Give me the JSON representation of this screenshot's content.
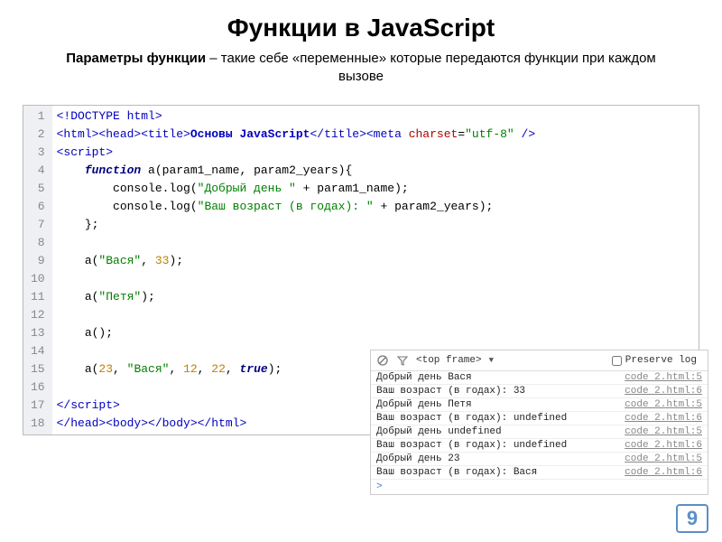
{
  "header": {
    "title": "Функции в JavaScript",
    "subtitle_bold": "Параметры функции",
    "subtitle_rest": " – такие себе «переменные» которые передаются функции при каждом вызове"
  },
  "editor": {
    "lines": [
      {
        "n": 1,
        "tokens": [
          {
            "t": "<!DOCTYPE html>",
            "c": "tag"
          }
        ]
      },
      {
        "n": 2,
        "tokens": [
          {
            "t": "<html><head><title>",
            "c": "tag"
          },
          {
            "t": "Основы JavaScript",
            "c": "kw"
          },
          {
            "t": "</title><meta",
            "c": "tag"
          },
          {
            "t": " ",
            "c": "plain"
          },
          {
            "t": "charset",
            "c": "attr"
          },
          {
            "t": "=",
            "c": "punct"
          },
          {
            "t": "\"utf-8\"",
            "c": "str"
          },
          {
            "t": " />",
            "c": "tag"
          }
        ]
      },
      {
        "n": 3,
        "tokens": [
          {
            "t": "<script>",
            "c": "tag"
          }
        ]
      },
      {
        "n": 4,
        "tokens": [
          {
            "t": "    ",
            "c": "plain"
          },
          {
            "t": "function",
            "c": "kw2"
          },
          {
            "t": " a(param1_name, param2_years){",
            "c": "plain"
          }
        ]
      },
      {
        "n": 5,
        "tokens": [
          {
            "t": "        console.log(",
            "c": "plain"
          },
          {
            "t": "\"Добрый день \"",
            "c": "str2"
          },
          {
            "t": " + param1_name);",
            "c": "plain"
          }
        ]
      },
      {
        "n": 6,
        "tokens": [
          {
            "t": "        console.log(",
            "c": "plain"
          },
          {
            "t": "\"Ваш возраст (в годах): \"",
            "c": "str2"
          },
          {
            "t": " + param2_years);",
            "c": "plain"
          }
        ]
      },
      {
        "n": 7,
        "tokens": [
          {
            "t": "    };",
            "c": "plain"
          }
        ]
      },
      {
        "n": 8,
        "tokens": []
      },
      {
        "n": 9,
        "tokens": [
          {
            "t": "    a(",
            "c": "plain"
          },
          {
            "t": "\"Вася\"",
            "c": "str2"
          },
          {
            "t": ", ",
            "c": "plain"
          },
          {
            "t": "33",
            "c": "num"
          },
          {
            "t": ");",
            "c": "plain"
          }
        ]
      },
      {
        "n": 10,
        "tokens": []
      },
      {
        "n": 11,
        "tokens": [
          {
            "t": "    a(",
            "c": "plain"
          },
          {
            "t": "\"Петя\"",
            "c": "str2"
          },
          {
            "t": ");",
            "c": "plain"
          }
        ]
      },
      {
        "n": 12,
        "tokens": []
      },
      {
        "n": 13,
        "tokens": [
          {
            "t": "    a();",
            "c": "plain"
          }
        ]
      },
      {
        "n": 14,
        "tokens": []
      },
      {
        "n": 15,
        "tokens": [
          {
            "t": "    a(",
            "c": "plain"
          },
          {
            "t": "23",
            "c": "num"
          },
          {
            "t": ", ",
            "c": "plain"
          },
          {
            "t": "\"Вася\"",
            "c": "str2"
          },
          {
            "t": ", ",
            "c": "plain"
          },
          {
            "t": "12",
            "c": "num"
          },
          {
            "t": ", ",
            "c": "plain"
          },
          {
            "t": "22",
            "c": "num"
          },
          {
            "t": ", ",
            "c": "plain"
          },
          {
            "t": "true",
            "c": "bool"
          },
          {
            "t": ");",
            "c": "plain"
          }
        ]
      },
      {
        "n": 16,
        "tokens": []
      },
      {
        "n": 17,
        "tokens": [
          {
            "t": "</script>",
            "c": "tag"
          }
        ]
      },
      {
        "n": 18,
        "tokens": [
          {
            "t": "</head><body></body></html>",
            "c": "tag"
          }
        ]
      }
    ]
  },
  "console": {
    "frame_label": "<top frame>",
    "preserve_label": "Preserve log",
    "rows": [
      {
        "msg": "Добрый день Вася",
        "src": "code 2.html:5"
      },
      {
        "msg": "Ваш возраст (в годах): 33",
        "src": "code 2.html:6"
      },
      {
        "msg": "Добрый день Петя",
        "src": "code 2.html:5"
      },
      {
        "msg": "Ваш возраст (в годах): undefined",
        "src": "code 2.html:6"
      },
      {
        "msg": "Добрый день undefined",
        "src": "code 2.html:5"
      },
      {
        "msg": "Ваш возраст (в годах): undefined",
        "src": "code 2.html:6"
      },
      {
        "msg": "Добрый день 23",
        "src": "code 2.html:5"
      },
      {
        "msg": "Ваш возраст (в годах): Вася",
        "src": "code 2.html:6"
      }
    ],
    "prompt": ">"
  },
  "page_number": "9"
}
